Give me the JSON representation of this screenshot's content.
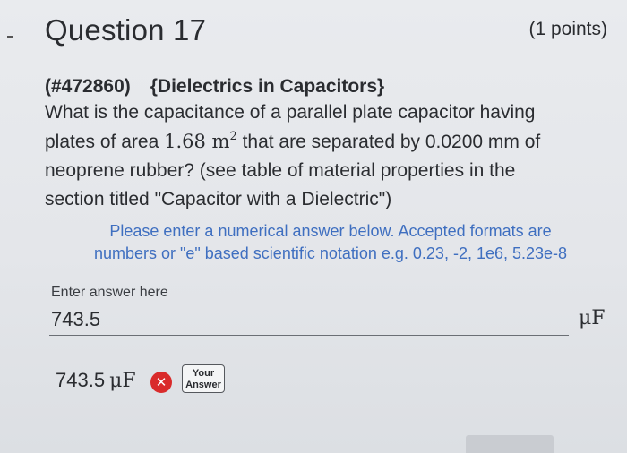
{
  "question": {
    "title": "Question 17",
    "points": "(1 points)",
    "id": "(#472860)",
    "topic": "{Dielectrics in Capacitors}",
    "body_line1": "What is the capacitance of a parallel plate capacitor having",
    "body_line2_a": "plates of area ",
    "area_value": "1.68 m",
    "area_exp": "2",
    "body_line2_b": " that are separated by 0.0200 mm of",
    "body_line3": "neoprene rubber? (see table of material properties in the",
    "body_line4": "section titled \"Capacitor with a Dielectric\")"
  },
  "hint": {
    "line1": "Please enter a numerical answer below. Accepted formats are",
    "line2": "numbers or \"e\" based scientific notation e.g. 0.23, -2, 1e6, 5.23e-8"
  },
  "answer": {
    "label": "Enter answer here",
    "value": "743.5",
    "unit": "μF"
  },
  "result": {
    "value": "743.5",
    "unit": "μF",
    "status_icon": "incorrect-x-icon",
    "status_glyph": "✕",
    "badge_line1": "Your",
    "badge_line2": "Answer"
  },
  "colors": {
    "hint": "#3f6fc0",
    "incorrect": "#d92b2b"
  }
}
